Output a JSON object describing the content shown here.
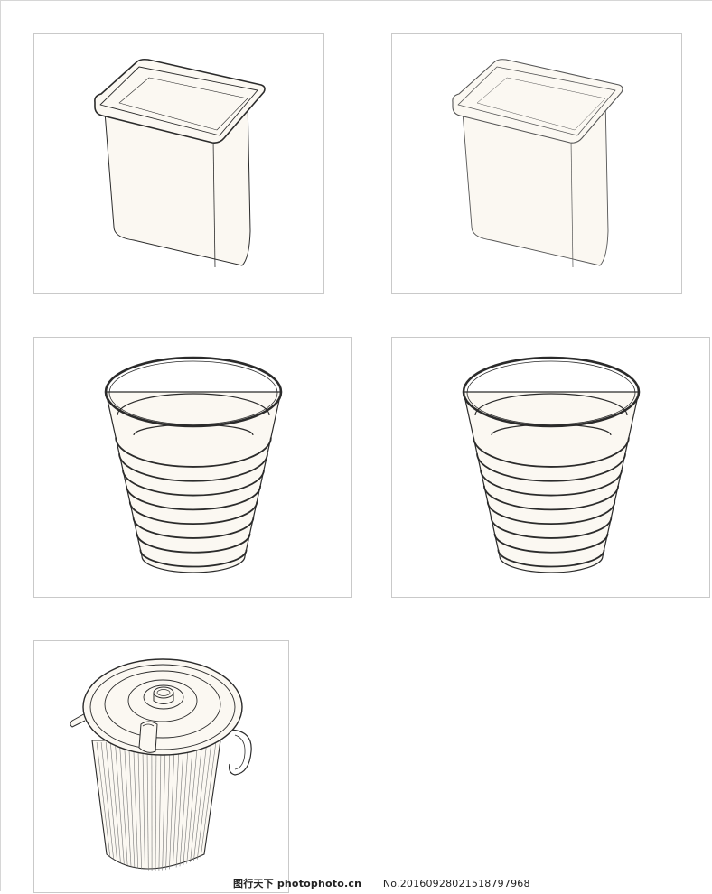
{
  "watermark": {
    "site": "图行天下 photophoto.cn",
    "number": "No.20160928021518797968"
  },
  "items": [
    {
      "name": "square-bin-1",
      "kind": "square"
    },
    {
      "name": "square-bin-2",
      "kind": "square"
    },
    {
      "name": "ribbed-bin-1",
      "kind": "ribbed"
    },
    {
      "name": "ribbed-bin-2",
      "kind": "ribbed"
    },
    {
      "name": "lidded-bin",
      "kind": "lidded"
    }
  ],
  "colors": {
    "fill": "#fbf8f2",
    "stroke": "#2b2b2b",
    "frame_border": "#c9c9c9"
  }
}
